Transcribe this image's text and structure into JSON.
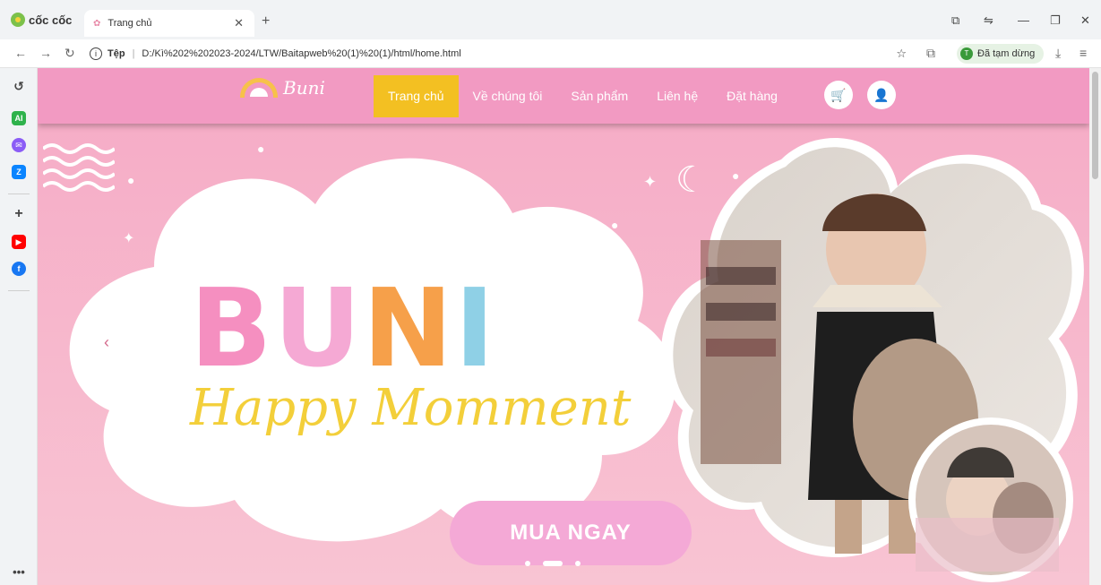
{
  "browser": {
    "brand": "cốc cốc",
    "tab_title": "Trang chủ",
    "url_scheme": "Tệp",
    "url": "D:/Kì%202%202023-2024/LTW/Baitapweb%20(1)%20(1)/html/home.html",
    "profile_initial": "T",
    "profile_status": "Đã tạm dừng"
  },
  "header": {
    "logo_text": "Buni",
    "menu": [
      "Trang chủ",
      "Về chúng tôi",
      "Sản phẩm",
      "Liên hệ",
      "Đặt hàng"
    ],
    "active_menu": "Trang chủ"
  },
  "hero": {
    "title_letters": [
      "B",
      "U",
      "N",
      "I"
    ],
    "title_colors": [
      "#f58fc0",
      "#f5a9d4",
      "#f6a04a",
      "#8fd0e6"
    ],
    "tagline": "Happy Momment",
    "cta": "MUA NGAY",
    "slide_count": 3,
    "active_slide": 2
  },
  "colors": {
    "header_bg": "#f29ac2",
    "active_menu_bg": "#f3c022",
    "hero_bg": "#f6adc7"
  },
  "sidebar_icons": [
    "history-icon",
    "ai-icon",
    "messenger-icon",
    "zalo-icon",
    "add-icon",
    "youtube-icon",
    "facebook-icon",
    "more-icon"
  ]
}
